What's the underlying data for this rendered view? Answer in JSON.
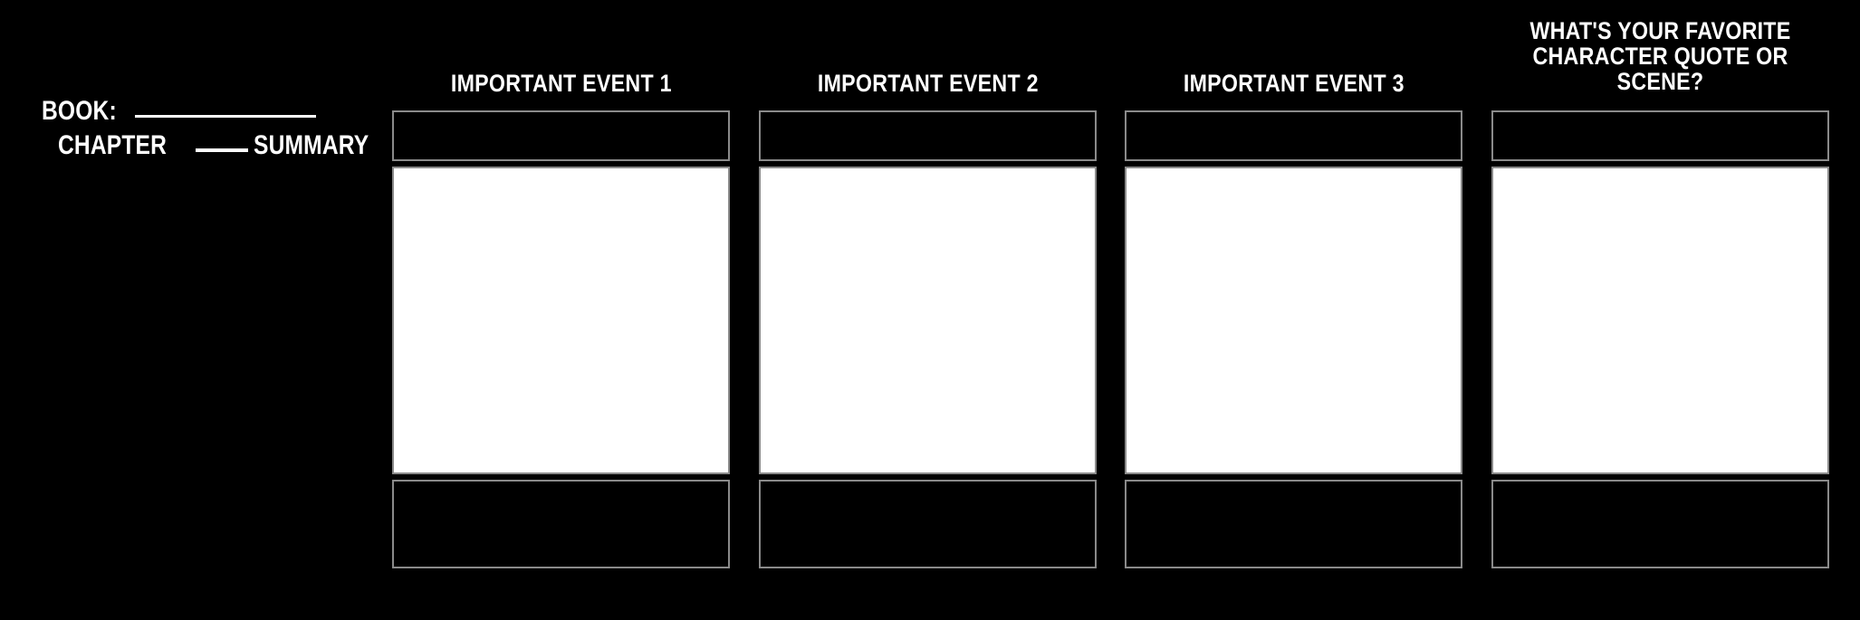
{
  "page": {
    "background_color": "#000000",
    "text_color": "#ffffff",
    "cell_border_color": "#8a8a8a",
    "art_cell_color": "#ffffff"
  },
  "caption": {
    "line1_label": "BOOK:",
    "line1_blank": "",
    "line2_prefix": "CHAPTER",
    "line2_blank": "",
    "line2_suffix": "SUMMARY"
  },
  "columns": [
    {
      "header": "IMPORTANT EVENT 1",
      "header_line2": "",
      "title_cell_text": "",
      "art_cell_text": "",
      "description_cell_text": ""
    },
    {
      "header": "IMPORTANT EVENT 2",
      "header_line2": "",
      "title_cell_text": "",
      "art_cell_text": "",
      "description_cell_text": ""
    },
    {
      "header": "IMPORTANT EVENT 3",
      "header_line2": "",
      "title_cell_text": "",
      "art_cell_text": "",
      "description_cell_text": ""
    },
    {
      "header": "WHAT'S YOUR FAVORITE",
      "header_line2": "CHARACTER QUOTE OR SCENE?",
      "title_cell_text": "",
      "art_cell_text": "",
      "description_cell_text": ""
    }
  ]
}
